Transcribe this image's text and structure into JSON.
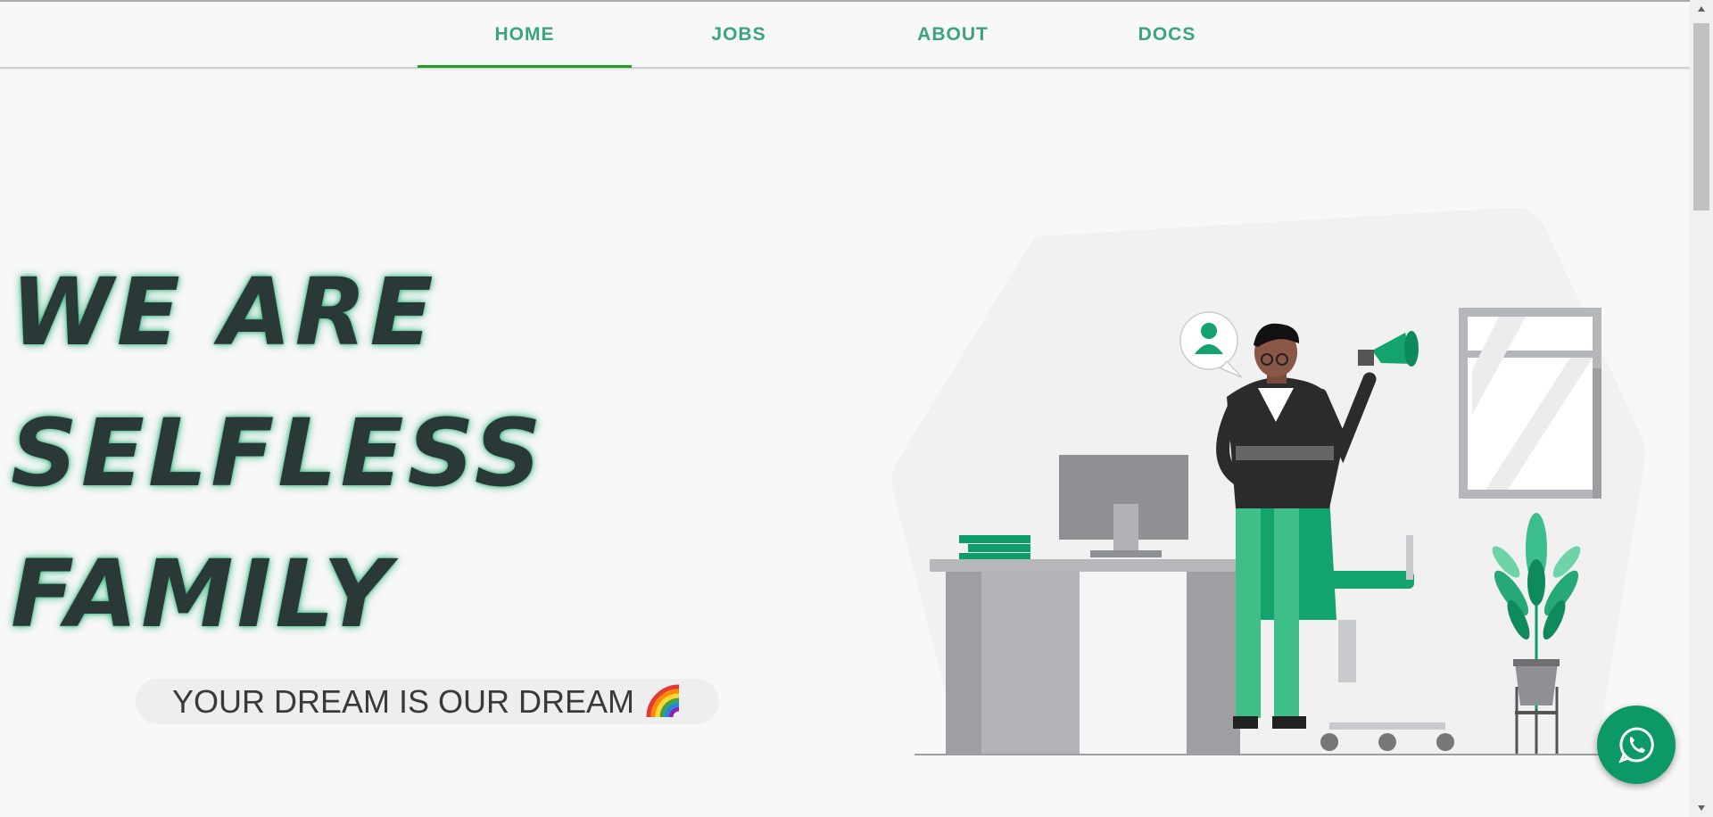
{
  "nav": {
    "tabs": [
      {
        "label": "HOME",
        "active": true
      },
      {
        "label": "JOBS",
        "active": false
      },
      {
        "label": "ABOUT",
        "active": false
      },
      {
        "label": "DOCS",
        "active": false
      }
    ]
  },
  "hero": {
    "line1": "WE ARE",
    "line2": "SELFLESS",
    "line3": "FAMILY",
    "tagline": "YOUR DREAM IS OUR DREAM"
  },
  "icons": {
    "tagline_emoji": "rainbow-icon",
    "floating_button": "whatsapp-icon",
    "speech_bubble": "user-icon",
    "megaphone": "megaphone-icon"
  },
  "colors": {
    "accent": "#0d9966",
    "nav_text": "#3aa57c",
    "active_underline": "#20a020",
    "headline": "#2b3838",
    "headline_glow": "#1aaa6e",
    "background": "#f8f8f8"
  }
}
